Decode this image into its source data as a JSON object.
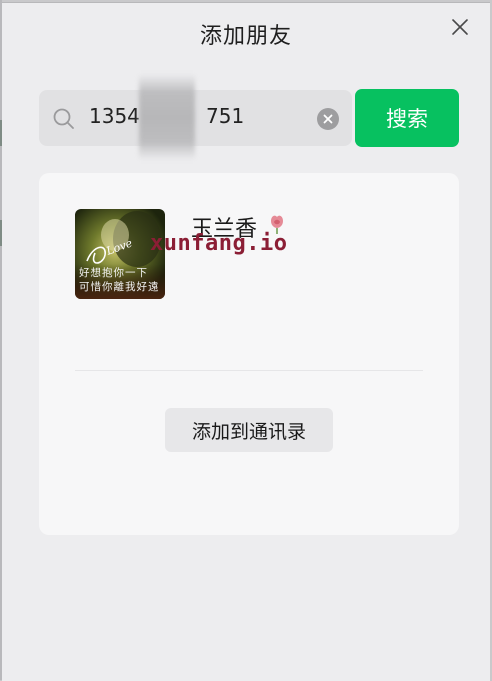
{
  "window": {
    "title": "添加朋友"
  },
  "search": {
    "query_visible_start": "1354",
    "query_visible_end": "751",
    "submit_label": "搜索"
  },
  "result": {
    "nickname": "玉兰香",
    "avatar_caption_line1": "好想抱你一下",
    "avatar_caption_line2": "可惜你離我好遠",
    "avatar_script_text": "Love",
    "add_button_label": "添加到通讯录"
  },
  "watermark": {
    "text": "xunfang.io",
    "color": "#8b1e35"
  },
  "colors": {
    "accent": "#07c160",
    "background": "#ededef",
    "card": "#f7f7f8"
  },
  "icons": {
    "close": "close-icon",
    "search": "search-icon",
    "clear": "clear-icon",
    "flower": "flower-emoji-icon"
  }
}
